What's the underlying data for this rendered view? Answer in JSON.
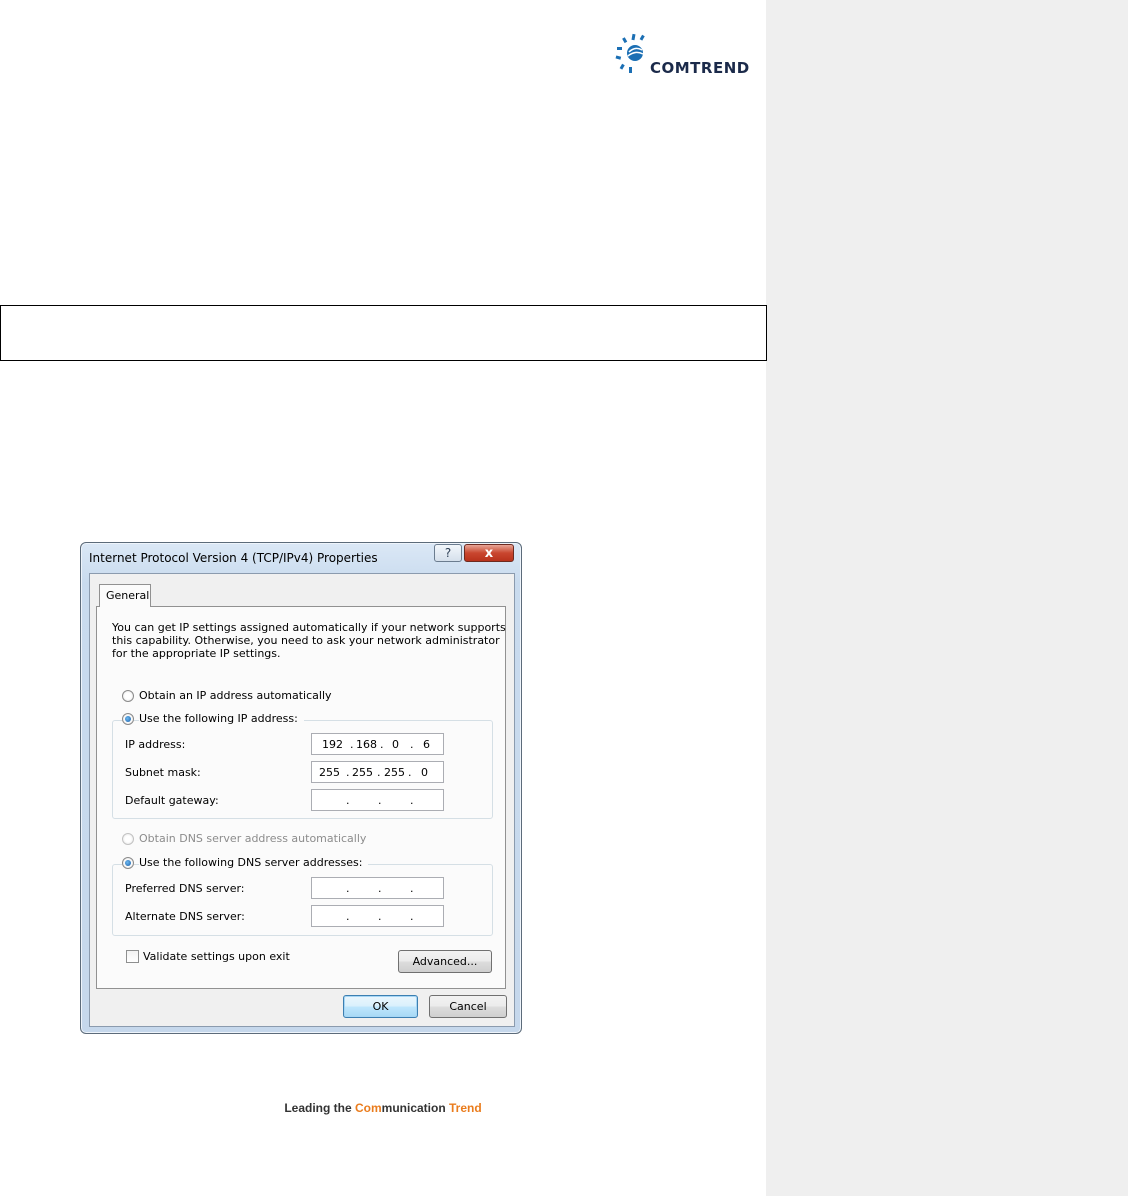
{
  "logo": {
    "name": "COMTREND",
    "colors": {
      "mark": "#1b6fb4",
      "text": "#1b2a4a"
    }
  },
  "dialog": {
    "title": "Internet Protocol Version 4 (TCP/IPv4) Properties",
    "help_label": "?",
    "close_label": "x",
    "tab_label": "General",
    "intro_lines": [
      "You can get IP settings assigned automatically if your network supports",
      "this capability. Otherwise, you need to ask your network administrator",
      "for the appropriate IP settings."
    ],
    "radio_auto_ip": "Obtain an IP address automatically",
    "radio_manual_ip": "Use the following IP address:",
    "ip_address_label": "IP address:",
    "ip_address": [
      "192",
      "168",
      "0",
      "6"
    ],
    "subnet_label": "Subnet mask:",
    "subnet": [
      "255",
      "255",
      "255",
      "0"
    ],
    "gateway_label": "Default gateway:",
    "radio_auto_dns": "Obtain DNS server address automatically",
    "radio_manual_dns": "Use the following DNS server addresses:",
    "pref_dns_label": "Preferred DNS server:",
    "alt_dns_label": "Alternate DNS server:",
    "validate_label": "Validate settings upon exit",
    "validate_checked": false,
    "advanced_label": "Advanced...",
    "ok_label": "OK",
    "cancel_label": "Cancel"
  },
  "footer": {
    "part1": "Leading the ",
    "part2": "Com",
    "part3": "munication ",
    "part4": "Trend",
    "accent_color": "#ea7c1d"
  }
}
